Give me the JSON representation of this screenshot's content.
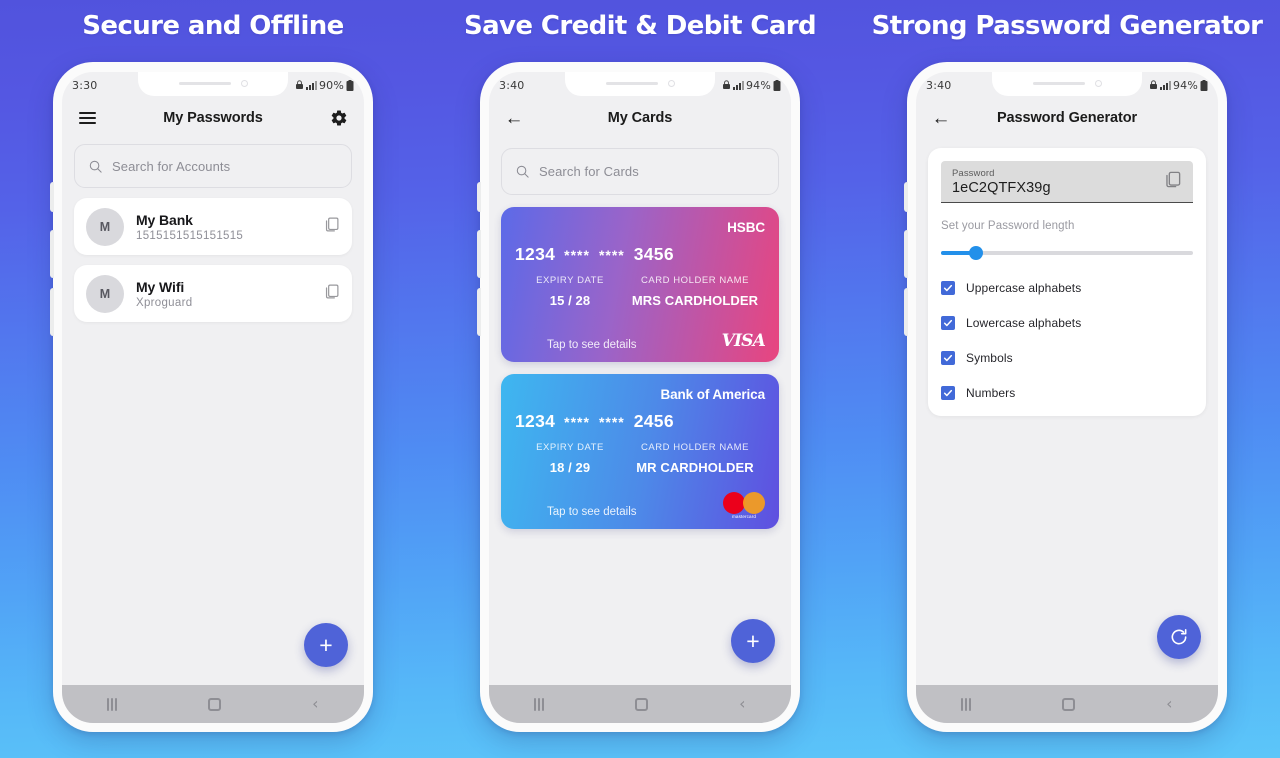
{
  "background": {
    "top_color": "#5153dd",
    "bottom_color": "#5cc6f9"
  },
  "accent": {
    "primary": "#4f63d8",
    "slider": "#2390ea",
    "checkbox": "#4169d8"
  },
  "panels": [
    {
      "title": "Secure and Offline",
      "status": {
        "time": "3:30",
        "battery": "90%"
      },
      "appbar": {
        "title": "My Passwords",
        "left_icon": "hamburger-icon",
        "right_icon": "gear-icon"
      },
      "search": {
        "placeholder": "Search for Accounts",
        "icon": "search-icon"
      },
      "items": [
        {
          "avatar": "M",
          "title": "My Bank",
          "subtitle": "1515151515151515",
          "copy_icon": "copy-icon"
        },
        {
          "avatar": "M",
          "title": "My Wifi",
          "subtitle": "Xproguard",
          "copy_icon": "copy-icon"
        }
      ],
      "fab": {
        "icon": "plus-icon",
        "label": "+"
      }
    },
    {
      "title": "Save Credit & Debit Card",
      "status": {
        "time": "3:40",
        "battery": "94%"
      },
      "appbar": {
        "title": "My Cards",
        "left_icon": "back-arrow-icon"
      },
      "search": {
        "placeholder": "Search for Cards",
        "icon": "search-icon"
      },
      "cards": [
        {
          "bank": "HSBC",
          "num_first": "1234",
          "num_mask_1": "****",
          "num_mask_2": "****",
          "num_last": "3456",
          "expiry_label": "EXPIRY DATE",
          "expiry_value": "15 / 28",
          "holder_label": "CARD HOLDER NAME",
          "holder_value": "MRS CARDHOLDER",
          "tap_text": "Tap to see details",
          "brand": "VISA",
          "brand_icon": "visa-logo"
        },
        {
          "bank": "Bank of America",
          "num_first": "1234",
          "num_mask_1": "****",
          "num_mask_2": "****",
          "num_last": "2456",
          "expiry_label": "EXPIRY DATE",
          "expiry_value": "18 / 29",
          "holder_label": "CARD HOLDER NAME",
          "holder_value": "MR CARDHOLDER",
          "tap_text": "Tap to see details",
          "brand": "mastercard",
          "brand_icon": "mastercard-logo"
        }
      ],
      "fab": {
        "icon": "plus-icon",
        "label": "+"
      }
    },
    {
      "title": "Strong Password Generator",
      "status": {
        "time": "3:40",
        "battery": "94%"
      },
      "appbar": {
        "title": "Password Generator",
        "left_icon": "back-arrow-icon"
      },
      "generator": {
        "password_label": "Password",
        "password_value": "1eC2QTFX39g",
        "copy_icon": "copy-icon",
        "length_label": "Set your Password length",
        "slider_percent": 14,
        "options": [
          {
            "label": "Uppercase alphabets",
            "checked": true
          },
          {
            "label": "Lowercase alphabets",
            "checked": true
          },
          {
            "label": "Symbols",
            "checked": true
          },
          {
            "label": "Numbers",
            "checked": true
          }
        ]
      },
      "fab": {
        "icon": "refresh-icon",
        "label": ""
      }
    }
  ],
  "navbar": {
    "recents": "recents-icon",
    "home": "home-icon",
    "back": "back-icon"
  }
}
